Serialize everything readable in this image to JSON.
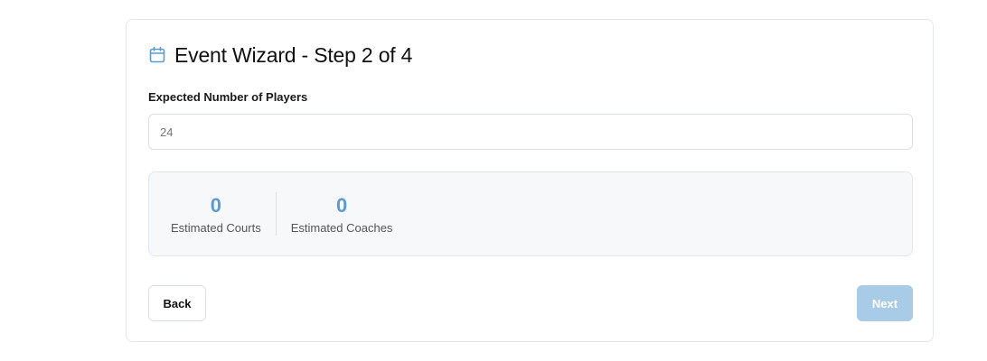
{
  "wizard": {
    "title": "Event Wizard - Step 2 of 4",
    "title_icon": "calendar-icon",
    "accent_color": "#5b9bd5"
  },
  "players_field": {
    "label": "Expected Number of Players",
    "placeholder": "24",
    "value": ""
  },
  "estimates": {
    "courts": {
      "value": "0",
      "label": "Estimated Courts"
    },
    "coaches": {
      "value": "0",
      "label": "Estimated Coaches"
    }
  },
  "actions": {
    "back_label": "Back",
    "next_label": "Next",
    "next_color_disabled": "#a8cbe8"
  }
}
